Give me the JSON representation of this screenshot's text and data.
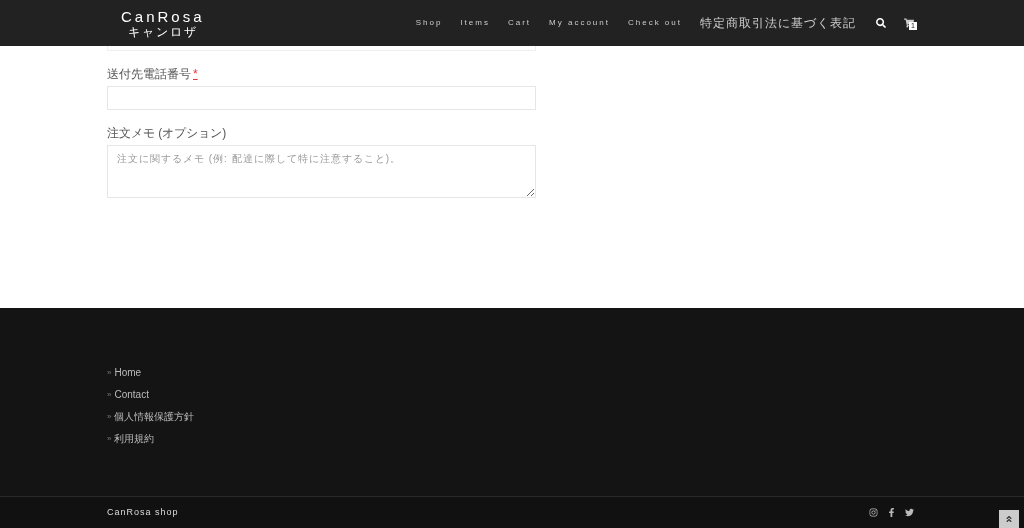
{
  "header": {
    "logo": "CanRosa",
    "logo_sub": "キャンロザ",
    "nav": [
      {
        "label": "Shop"
      },
      {
        "label": "Items"
      },
      {
        "label": "Cart"
      },
      {
        "label": "My account"
      },
      {
        "label": "Check out"
      },
      {
        "label": "特定商取引法に基づく表記"
      }
    ],
    "cart_count": "1"
  },
  "form": {
    "fields": [
      {
        "kind": "input",
        "label": "送付先電話番号",
        "required_mark": "*"
      },
      {
        "kind": "textarea",
        "label": "注文メモ (オプション)",
        "placeholder": "注文に関するメモ (例: 配達に際して特に注意すること)。"
      }
    ]
  },
  "footer": {
    "links": [
      {
        "bullet": "»",
        "label": "Home"
      },
      {
        "bullet": "»",
        "label": "Contact"
      },
      {
        "bullet": "»",
        "label": "個人情報保護方針"
      },
      {
        "bullet": "»",
        "label": "利用規約"
      }
    ],
    "copyright": "CanRosa shop"
  }
}
